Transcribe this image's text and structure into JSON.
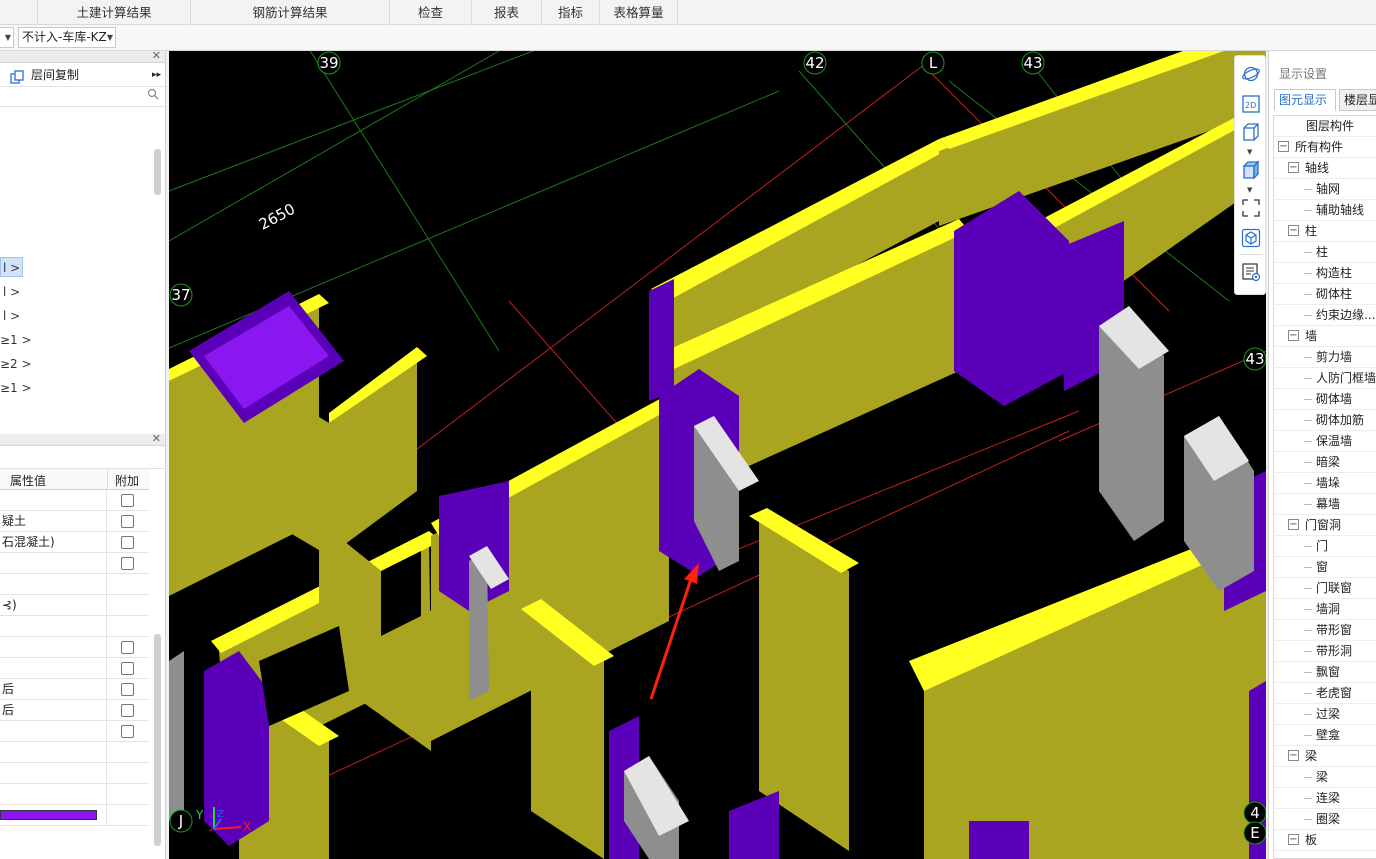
{
  "tabs": [
    {
      "label": "土建计算结果"
    },
    {
      "label": "钢筋计算结果"
    },
    {
      "label": "检查"
    },
    {
      "label": "报表"
    },
    {
      "label": "指标"
    },
    {
      "label": "表格算量"
    }
  ],
  "toolbar": {
    "combo2_value": "不计入-车库-KZ"
  },
  "left_panel": {
    "copy_label": "层间复制",
    "tree_items": [
      "l >",
      "l >",
      "l >",
      "≥1 >",
      "≥2 >",
      "≥1 >"
    ],
    "props_header": {
      "col_value": "属性值",
      "col_extra": "附加"
    },
    "prop_rows": [
      {
        "value": "",
        "check": true
      },
      {
        "value": "疑土",
        "check": true
      },
      {
        "value": "石混凝土)",
        "check": true
      },
      {
        "value": "",
        "check": true
      },
      {
        "value": "",
        "check": false
      },
      {
        "value": "⊰)",
        "check": false
      },
      {
        "value": "",
        "check": false
      },
      {
        "value": "",
        "check": true
      },
      {
        "value": "",
        "check": true
      },
      {
        "value": "后",
        "check": true
      },
      {
        "value": "后",
        "check": true
      },
      {
        "value": "",
        "check": true
      },
      {
        "value": "",
        "check": false
      },
      {
        "value": "",
        "check": false
      },
      {
        "value": "",
        "check": false
      },
      {
        "value": "",
        "check": false
      }
    ],
    "prop_color": "#8a16f0"
  },
  "viewport": {
    "dimension": "2650",
    "axis_labels": [
      "39",
      "42",
      "L",
      "43",
      "37",
      "43",
      "J",
      "4",
      "E"
    ],
    "colors": {
      "wall": "#a9a520",
      "wall_top": "#ffff22",
      "column": "#5a00b8",
      "column_top": "#8a16f0",
      "door": "#8e8e8e",
      "door_top": "#e4e4e4",
      "grid_green": "#1b7a1b",
      "grid_red": "#c0201d",
      "arrow": "#ff2010"
    },
    "axes": {
      "x": "X",
      "y": "Y",
      "z": "Z"
    }
  },
  "view_tools": [
    {
      "icon": "orbit-icon"
    },
    {
      "icon": "2d-view-icon",
      "text": "2D"
    },
    {
      "icon": "3d-box-icon"
    },
    {
      "icon": "3d-solid-box-icon"
    },
    {
      "icon": "fullscreen-frame-icon"
    },
    {
      "icon": "cube-view-icon"
    },
    {
      "icon": "display-settings-icon"
    }
  ],
  "right_panel": {
    "title": "显示设置",
    "tab1": "图元显示",
    "tab2": "楼层显",
    "header": "图层构件",
    "rows": [
      {
        "label": "所有构件",
        "level": 0,
        "box": "−"
      },
      {
        "label": "轴线",
        "level": 1,
        "box": "−"
      },
      {
        "label": "轴网",
        "level": 2
      },
      {
        "label": "辅助轴线",
        "level": 2
      },
      {
        "label": "柱",
        "level": 1,
        "box": "−"
      },
      {
        "label": "柱",
        "level": 2
      },
      {
        "label": "构造柱",
        "level": 2
      },
      {
        "label": "砌体柱",
        "level": 2
      },
      {
        "label": "约束边缘...",
        "level": 2
      },
      {
        "label": "墙",
        "level": 1,
        "box": "−"
      },
      {
        "label": "剪力墙",
        "level": 2
      },
      {
        "label": "人防门框墙",
        "level": 2
      },
      {
        "label": "砌体墙",
        "level": 2
      },
      {
        "label": "砌体加筋",
        "level": 2
      },
      {
        "label": "保温墙",
        "level": 2
      },
      {
        "label": "暗梁",
        "level": 2
      },
      {
        "label": "墙垛",
        "level": 2
      },
      {
        "label": "幕墙",
        "level": 2
      },
      {
        "label": "门窗洞",
        "level": 1,
        "box": "−"
      },
      {
        "label": "门",
        "level": 2
      },
      {
        "label": "窗",
        "level": 2
      },
      {
        "label": "门联窗",
        "level": 2
      },
      {
        "label": "墙洞",
        "level": 2
      },
      {
        "label": "带形窗",
        "level": 2
      },
      {
        "label": "带形洞",
        "level": 2
      },
      {
        "label": "飘窗",
        "level": 2
      },
      {
        "label": "老虎窗",
        "level": 2
      },
      {
        "label": "过梁",
        "level": 2
      },
      {
        "label": "壁龛",
        "level": 2
      },
      {
        "label": "梁",
        "level": 1,
        "box": "−"
      },
      {
        "label": "梁",
        "level": 2
      },
      {
        "label": "连梁",
        "level": 2
      },
      {
        "label": "圈梁",
        "level": 2
      },
      {
        "label": "板",
        "level": 1,
        "box": "−"
      }
    ]
  }
}
